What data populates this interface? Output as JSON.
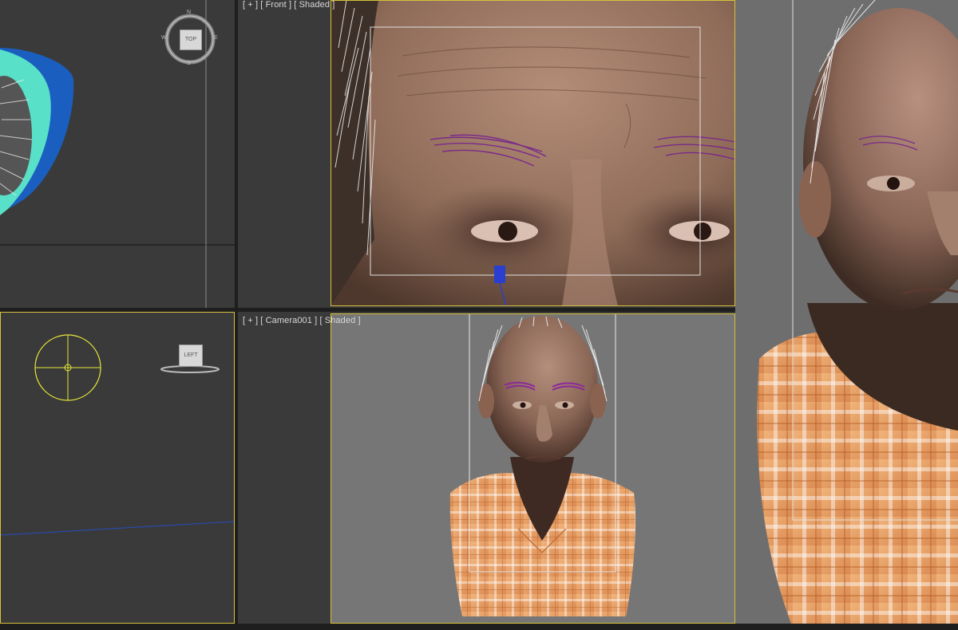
{
  "viewports": {
    "top": {
      "viewcube_label": "TOP",
      "compass_n": "N",
      "compass_s": "S",
      "compass_w": "W",
      "compass_e": "E"
    },
    "front": {
      "label": "[ + ] [ Front ] [ Shaded ]"
    },
    "left": {
      "viewcube_label": "LEFT"
    },
    "camera": {
      "label": "[ + ] [ Camera001 ] [ Shaded ]"
    },
    "perspective": {}
  },
  "colors": {
    "viewport_bg": "#3a3a3a",
    "render_bg": "#6e6e6e",
    "active_border": "#d6c23a",
    "skin": "#9b7660",
    "shirt": "#e8a060",
    "brows": "#7a2a8a"
  }
}
